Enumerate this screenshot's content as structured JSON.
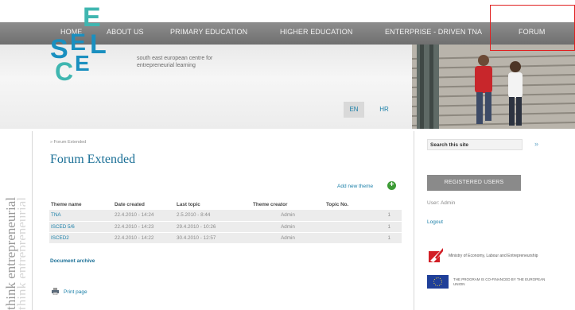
{
  "nav": {
    "items": [
      "HOME",
      "ABOUT US",
      "PRIMARY EDUCATION",
      "HIGHER EDUCATION",
      "ENTERPRISE - DRIVEN TNA",
      "FORUM"
    ]
  },
  "header": {
    "logo_letters": [
      "S",
      "E",
      "E",
      "C",
      "E",
      "L"
    ],
    "tagline": "south east european centre for entrepreneurial learning",
    "lang_en": "EN",
    "lang_hr": "HR"
  },
  "side_banner": "think entrepreneurial",
  "main": {
    "breadcrumb": "» Forum Extended",
    "title": "Forum Extended",
    "add_theme": "Add new theme",
    "table": {
      "headers": [
        "Theme name",
        "Date created",
        "Last topic",
        "Theme creator",
        "Topic No."
      ],
      "rows": [
        [
          "TNA",
          "22.4.2010 - 14:24",
          "2.5.2010 - 8:44",
          "Admin",
          "1"
        ],
        [
          "ISCED 5/6",
          "22.4.2010 - 14:23",
          "29.4.2010 - 10:26",
          "Admin",
          "1"
        ],
        [
          "ISCED2",
          "22.4.2010 - 14:22",
          "30.4.2010 - 12:57",
          "Admin",
          "1"
        ]
      ]
    },
    "archive": "Document archive",
    "print": "Print page"
  },
  "sidebar": {
    "search_value": "Search this site",
    "search_go": "»",
    "registered_header": "REGISTERED USERS",
    "user_line": "User: Admin",
    "logout": "Logout",
    "sponsor1": "Ministry of Economy, Labour and Entrepreneurship",
    "sponsor2": "THE PROGRAM IS CO-FINANCED BY THE EUROPEAN UNION"
  },
  "colors": {
    "nav_bg": "#7a7a7a",
    "link": "#1a7fa8",
    "logo_teal": "#1a8fbf",
    "logo_green": "#3fb6b0",
    "annotation": "#e02020"
  }
}
